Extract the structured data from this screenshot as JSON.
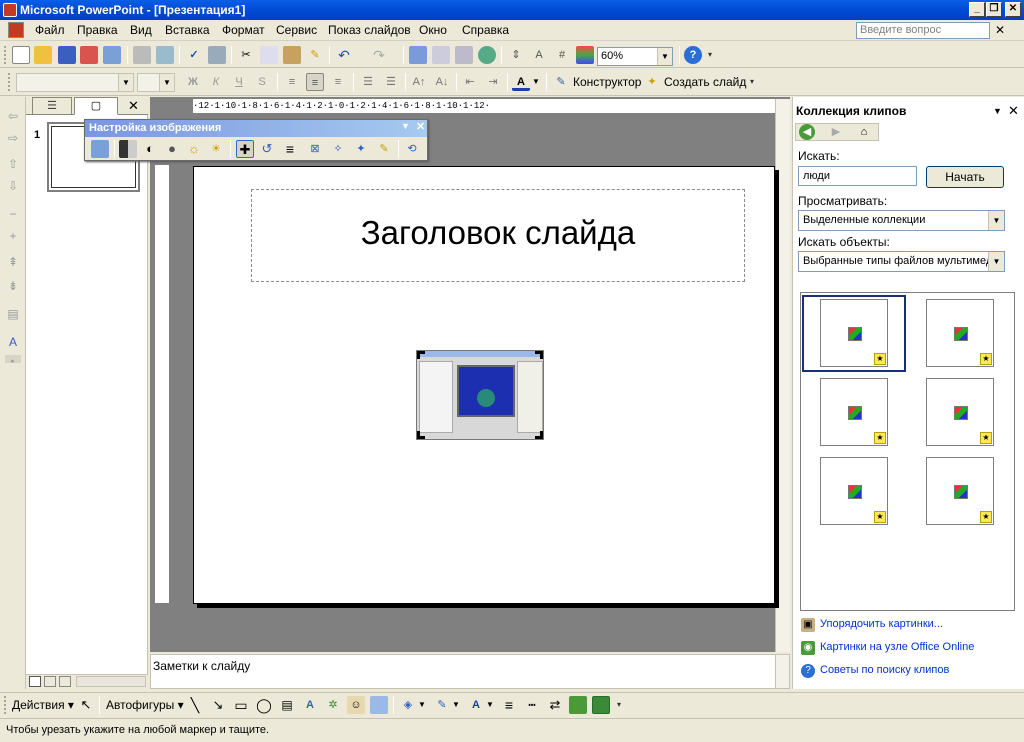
{
  "window": {
    "title": "Microsoft PowerPoint - [Презентация1]"
  },
  "menu": {
    "items": [
      "Файл",
      "Правка",
      "Вид",
      "Вставка",
      "Формат",
      "Сервис",
      "Показ слайдов",
      "Окно",
      "Справка"
    ],
    "ask_placeholder": "Введите вопрос"
  },
  "toolbar_standard": {
    "zoom": "60%"
  },
  "toolbar_formatting": {
    "designer_label": "Конструктор",
    "new_slide_label": "Создать слайд"
  },
  "ruler": {
    "horizontal_text": "·12·1·10·1·8·1·6·1·4·1·2·1·0·1·2·1·4·1·6·1·8·1·10·1·12·"
  },
  "slides_pane": {
    "slide_number": "1"
  },
  "picture_toolbar": {
    "title": "Настройка изображения"
  },
  "slide": {
    "title": "Заголовок слайда"
  },
  "notes": {
    "placeholder": "Заметки к слайду"
  },
  "task_pane": {
    "title": "Коллекция клипов",
    "search_label": "Искать:",
    "search_value": "люди",
    "start_button": "Начать",
    "browse_label": "Просматривать:",
    "browse_value": "Выделенные коллекции",
    "types_label": "Искать объекты:",
    "types_value": "Выбранные типы файлов мультимед",
    "links": [
      "Упорядочить картинки...",
      "Картинки на узле Office Online",
      "Советы по поиску клипов"
    ]
  },
  "drawing_toolbar": {
    "actions_label": "Действия",
    "autoshapes_label": "Автофигуры"
  },
  "status": {
    "text": "Чтобы урезать укажите на любой маркер и тащите."
  },
  "colors": {
    "titlebar": "#0a5ee8",
    "chrome": "#ece9d8",
    "link": "#0033cc",
    "workspace": "#808080"
  }
}
